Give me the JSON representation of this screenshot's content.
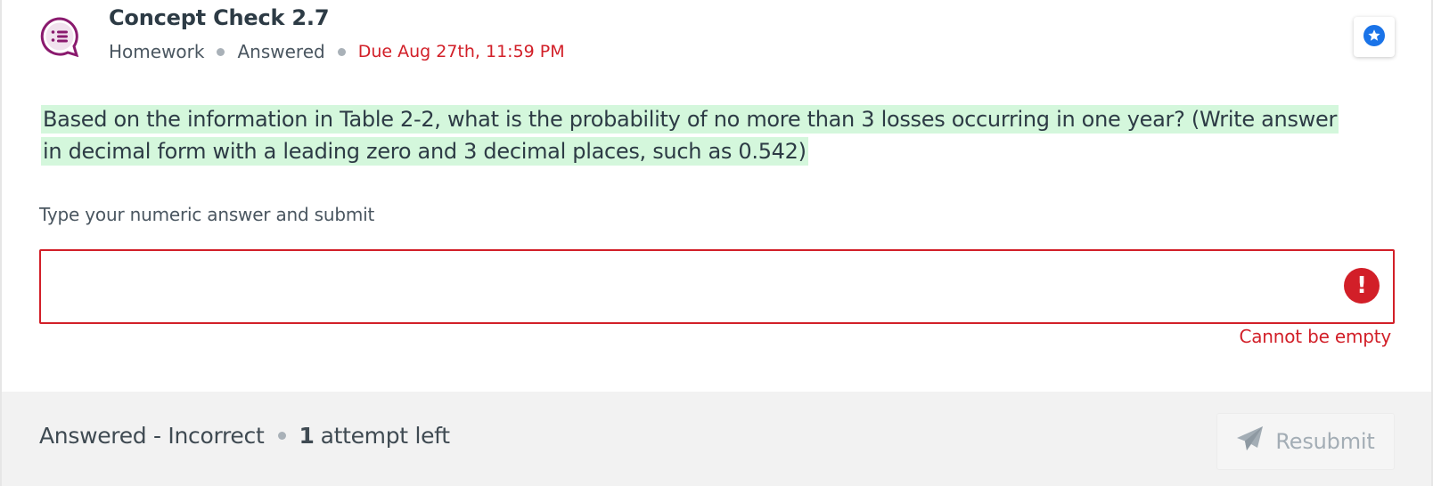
{
  "header": {
    "title": "Concept Check 2.7",
    "type": "Homework",
    "state": "Answered",
    "due": "Due Aug 27th, 11:59 PM",
    "icon": "discussion-bubble-icon",
    "star_icon": "star-icon"
  },
  "question": {
    "text": "Based on the information in Table 2-2, what is the probability of no more than 3 losses occurring in one year? (Write answer in decimal form with a leading zero and 3 decimal places, such as 0.542)"
  },
  "answer": {
    "prompt": "Type your numeric answer and submit",
    "value": "",
    "placeholder": "",
    "error_icon": "!",
    "error_message": "Cannot be empty"
  },
  "footer": {
    "status": "Answered - Incorrect",
    "attempts_count": "1",
    "attempts_label": "attempt left",
    "resubmit_label": "Resubmit",
    "resubmit_icon": "paper-plane-icon"
  },
  "colors": {
    "accent": "#8a1a6e",
    "error": "#d21f28",
    "highlight": "#d4f7dc",
    "star": "#1a73e8"
  }
}
